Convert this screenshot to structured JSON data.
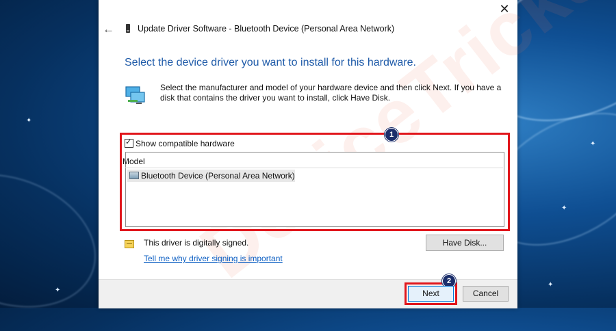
{
  "window": {
    "title": "Update Driver Software - Bluetooth Device (Personal Area Network)",
    "close_glyph": "✕",
    "back_glyph": "←"
  },
  "main": {
    "heading": "Select the device driver you want to install for this hardware.",
    "description": "Select the manufacturer and model of your hardware device and then click Next. If you have a disk that contains the driver you want to install, click Have Disk.",
    "show_compatible": {
      "label": "Show compatible hardware",
      "checked": true,
      "check_glyph": "✓"
    },
    "model_list": {
      "header": "Model",
      "items": [
        {
          "label": "Bluetooth Device (Personal Area Network)",
          "icon": "network-adapter-icon"
        }
      ]
    },
    "signed_status": "This driver is digitally signed.",
    "signing_link": "Tell me why driver signing is important",
    "have_disk_button": "Have Disk..."
  },
  "footer": {
    "next_button": "Next",
    "cancel_button": "Cancel"
  },
  "annotations": {
    "badge_1": "1",
    "badge_2": "2",
    "highlight_color": "#e1161c",
    "badge_color": "#1b2e6b"
  },
  "watermark": "DeviceTricks",
  "colors": {
    "heading": "#1e5aa8",
    "link": "#0a5dc2",
    "desktop_background": "#0f4f93"
  }
}
